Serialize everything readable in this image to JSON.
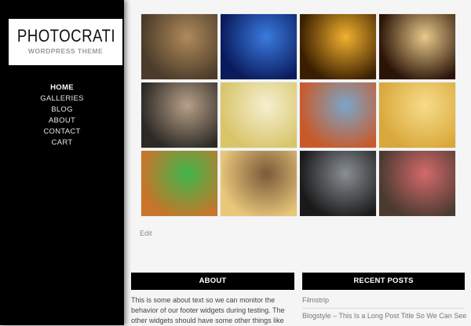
{
  "sidebar": {
    "logo_title": "PHOTOCRATI",
    "logo_subtitle": "WORDPRESS THEME",
    "nav": [
      "HOME",
      "GALLERIES",
      "BLOG",
      "ABOUT",
      "CONTACT",
      "CART"
    ],
    "active_index": 0
  },
  "gallery": {
    "images": [
      {
        "icon": "hand-with-keys-photo",
        "colors": [
          "#4a3b2a",
          "#b08a5a"
        ]
      },
      {
        "icon": "concert-crowd-blue-photo",
        "colors": [
          "#0a1a5c",
          "#3a7be0"
        ]
      },
      {
        "icon": "concert-stage-silhouette-photo",
        "colors": [
          "#3a1e00",
          "#f2b12e"
        ]
      },
      {
        "icon": "concert-crowd-lights-photo",
        "colors": [
          "#2a1408",
          "#e8c98a"
        ]
      },
      {
        "icon": "smiling-man-sunglasses-photo",
        "colors": [
          "#2d2a26",
          "#b7a088"
        ]
      },
      {
        "icon": "couple-with-bikes-photo",
        "colors": [
          "#d8c56a",
          "#f5efd0"
        ]
      },
      {
        "icon": "man-with-glasses-photo",
        "colors": [
          "#c85a2a",
          "#7aa6c9"
        ]
      },
      {
        "icon": "woman-in-sunlight-photo",
        "colors": [
          "#d9a83a",
          "#f7dc8a"
        ]
      },
      {
        "icon": "woman-in-green-photo",
        "colors": [
          "#c8742a",
          "#3fb54a"
        ]
      },
      {
        "icon": "couple-embracing-photo",
        "colors": [
          "#e8c67a",
          "#7a5a3a"
        ]
      },
      {
        "icon": "woman-by-window-photo",
        "colors": [
          "#1a1a1a",
          "#8a8f94"
        ]
      },
      {
        "icon": "woman-with-camera-photo",
        "colors": [
          "#4a3a30",
          "#d46a6a"
        ]
      }
    ],
    "edit_label": "Edit"
  },
  "footer": {
    "about": {
      "title": "ABOUT",
      "text": "This is some about text so we can monitor the behavior of our footer widgets during testing. The other widgets should have some other things like"
    },
    "recent_posts": {
      "title": "RECENT POSTS",
      "items": [
        "Filmstrip",
        "Blogstyle – This Is a Long Post Title So We Can See"
      ]
    }
  }
}
